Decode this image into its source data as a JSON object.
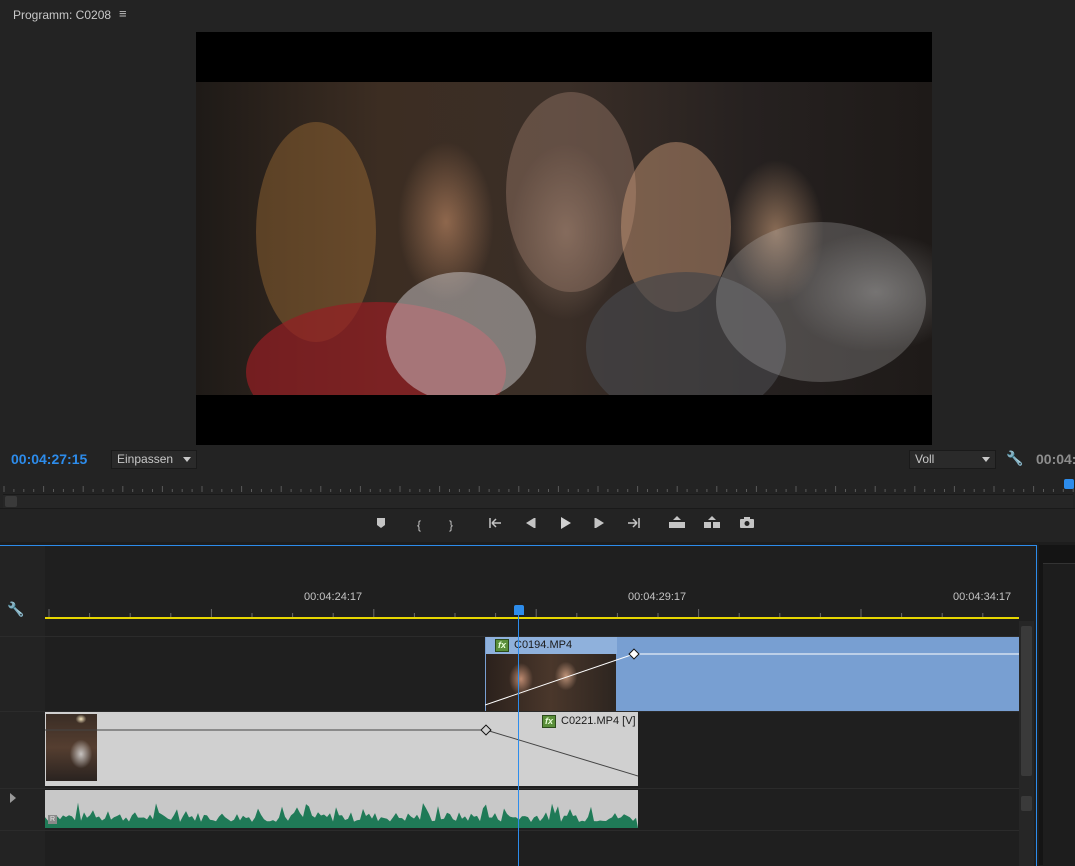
{
  "monitor": {
    "title": "Programm: C0208",
    "menu_icon": "hamburger-icon",
    "timecode_current": "00:04:27:15",
    "zoom_label": "Einpassen",
    "quality_label": "Voll",
    "timecode_duration": "00:04:",
    "transport_icons": [
      "add-marker-icon",
      "mark-in-icon",
      "mark-out-icon",
      "go-to-in-icon",
      "step-back-icon",
      "play-icon",
      "step-forward-icon",
      "go-to-out-icon",
      "lift-icon",
      "extract-icon",
      "export-frame-icon"
    ]
  },
  "timeline": {
    "tick_labels": [
      "00:04:24:17",
      "00:04:29:17",
      "00:04:34:17"
    ],
    "clips": {
      "upper_name": "C0194.MP4",
      "lower_name": "C0221.MP4 [V]",
      "fx_label": "fx",
      "audio_badge": "R"
    },
    "colors": {
      "playhead": "#2d8ceb",
      "work_area": "#e6d600",
      "upper_clip": "#789fd2",
      "lower_clip": "#d0d0d0",
      "audio_waveform": "#1f7a57"
    }
  }
}
